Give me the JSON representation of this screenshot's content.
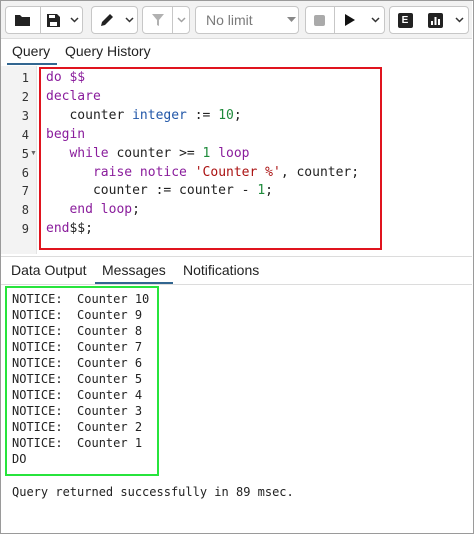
{
  "toolbar": {
    "limit": "No limit",
    "explain_label": "E"
  },
  "tabs_top": [
    "Query",
    "Query History"
  ],
  "editor": {
    "line_numbers": [
      "1",
      "2",
      "3",
      "4",
      "5",
      "6",
      "7",
      "8",
      "9"
    ],
    "lines": [
      [
        {
          "t": "do $$",
          "c": "kw"
        }
      ],
      [
        {
          "t": "declare",
          "c": "kw"
        }
      ],
      [
        {
          "t": "   counter ",
          "c": "kw2"
        },
        {
          "t": "integer",
          "c": "type"
        },
        {
          "t": " := ",
          "c": "kw2"
        },
        {
          "t": "10",
          "c": "num"
        },
        {
          "t": ";",
          "c": "kw2"
        }
      ],
      [
        {
          "t": "begin",
          "c": "kw"
        }
      ],
      [
        {
          "t": "   ",
          "c": "kw2"
        },
        {
          "t": "while",
          "c": "kw"
        },
        {
          "t": " counter >= ",
          "c": "kw2"
        },
        {
          "t": "1",
          "c": "num"
        },
        {
          "t": " ",
          "c": "kw2"
        },
        {
          "t": "loop",
          "c": "kw"
        }
      ],
      [
        {
          "t": "      ",
          "c": "kw2"
        },
        {
          "t": "raise notice",
          "c": "kw"
        },
        {
          "t": " ",
          "c": "kw2"
        },
        {
          "t": "'Counter %'",
          "c": "str"
        },
        {
          "t": ", counter;",
          "c": "kw2"
        }
      ],
      [
        {
          "t": "      counter := counter - ",
          "c": "kw2"
        },
        {
          "t": "1",
          "c": "num"
        },
        {
          "t": ";",
          "c": "kw2"
        }
      ],
      [
        {
          "t": "   ",
          "c": "kw2"
        },
        {
          "t": "end loop",
          "c": "kw"
        },
        {
          "t": ";",
          "c": "kw2"
        }
      ],
      [
        {
          "t": "end",
          "c": "kw"
        },
        {
          "t": "$$;",
          "c": "kw2"
        }
      ]
    ]
  },
  "tabs_bottom": [
    "Data Output",
    "Messages",
    "Notifications"
  ],
  "messages": [
    "NOTICE:  Counter 10",
    "NOTICE:  Counter 9",
    "NOTICE:  Counter 8",
    "NOTICE:  Counter 7",
    "NOTICE:  Counter 6",
    "NOTICE:  Counter 5",
    "NOTICE:  Counter 4",
    "NOTICE:  Counter 3",
    "NOTICE:  Counter 2",
    "NOTICE:  Counter 1",
    "DO"
  ],
  "status": "Query returned successfully in 89 msec.",
  "colors": {
    "highlight_code": "#e0141e",
    "highlight_output": "#27e43c",
    "active_tab": "#326690"
  }
}
